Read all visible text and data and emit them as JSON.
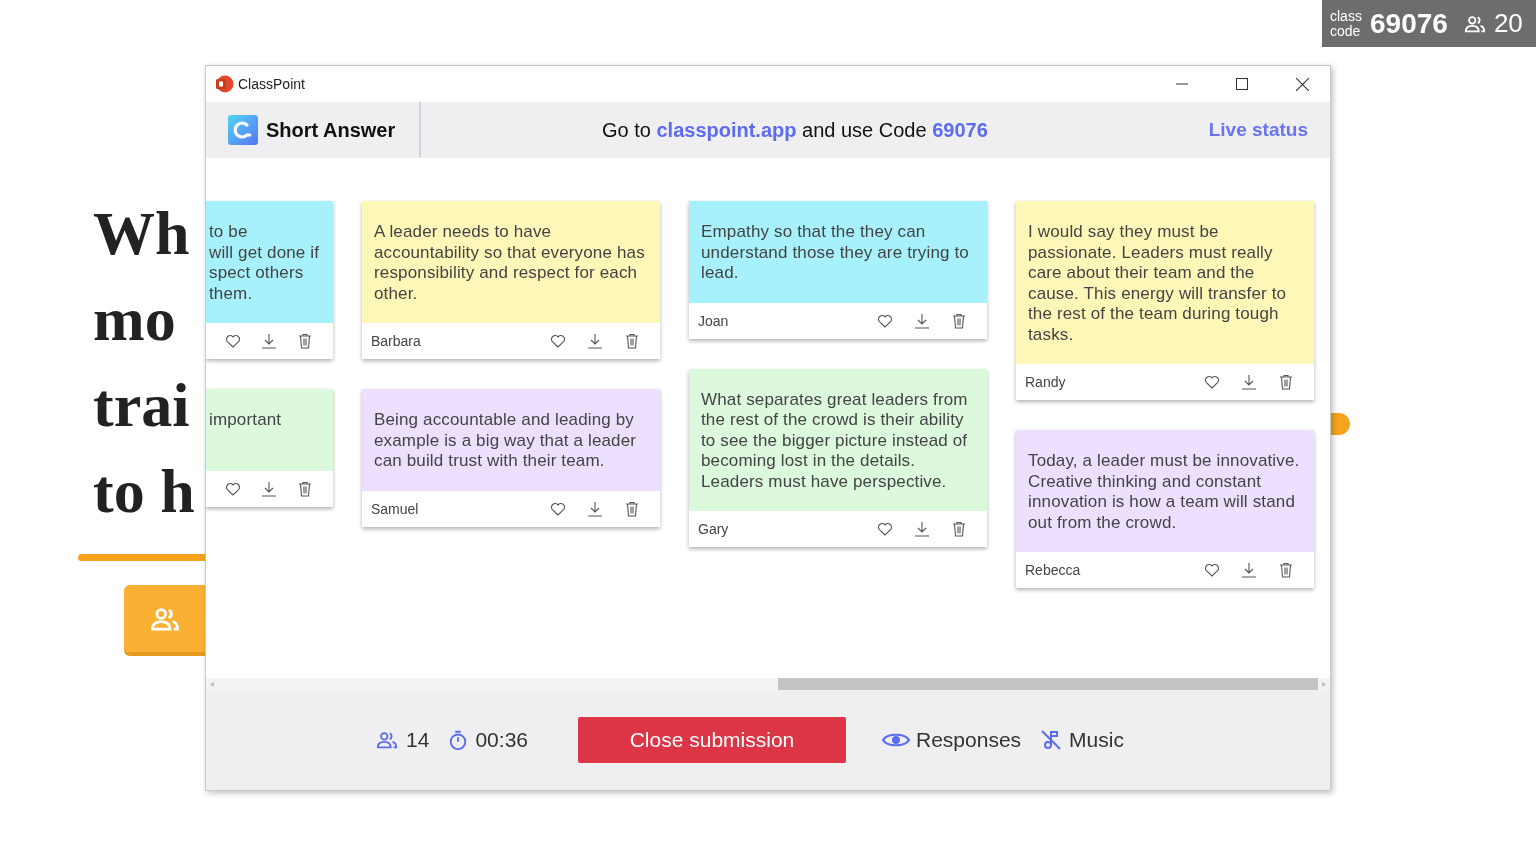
{
  "badge": {
    "label": "class code",
    "code": "69076",
    "count": "20"
  },
  "slide": {
    "title_lines": [
      "Wh",
      "mo",
      "trai",
      "to h"
    ]
  },
  "window": {
    "title": "ClassPoint"
  },
  "header": {
    "activity": "Short Answer",
    "prefix": "Go to",
    "site": "classpoint.app",
    "middle": "and use Code",
    "code": "69076",
    "live_status": "Live status"
  },
  "columns": [
    {
      "kind": "partial",
      "cards": [
        {
          "text": "to be\nwill get done if\nspect others\nthem.",
          "color": "#a6f1fb"
        },
        {
          "text": "important",
          "color": "#dcf8dd"
        }
      ]
    },
    {
      "kind": "full",
      "cards": [
        {
          "text": "A leader needs to have accountability so that everyone has responsibility and respect for each other.",
          "author": "Barbara",
          "color": "#fff7b8"
        },
        {
          "text": "Being accountable and leading by example is a big way that a leader can build trust with their team.",
          "author": "Samuel",
          "color": "#ede0ff"
        }
      ]
    },
    {
      "kind": "full",
      "cards": [
        {
          "text": "Empathy so that the they can understand those they are trying to lead.",
          "author": "Joan",
          "color": "#a6f1fb"
        },
        {
          "text": "What separates great leaders from the rest of the crowd is their ability to see the bigger picture instead of becoming lost in the details. Leaders must have perspective.",
          "author": "Gary",
          "color": "#dcf8dd"
        }
      ]
    },
    {
      "kind": "full",
      "cards": [
        {
          "text": "I would say they must be passionate. Leaders must really care about their team and the cause. This energy will transfer to the rest of the team during tough tasks.",
          "author": "Randy",
          "color": "#fff7b8"
        },
        {
          "text": "Today, a leader must be innovative. Creative thinking and constant innovation is how a team will stand out from the crowd.",
          "author": "Rebecca",
          "color": "#ede0ff"
        }
      ]
    }
  ],
  "footer": {
    "participants": "14",
    "timer": "00:36",
    "close_button": "Close submission",
    "responses": "Responses",
    "music": "Music"
  }
}
